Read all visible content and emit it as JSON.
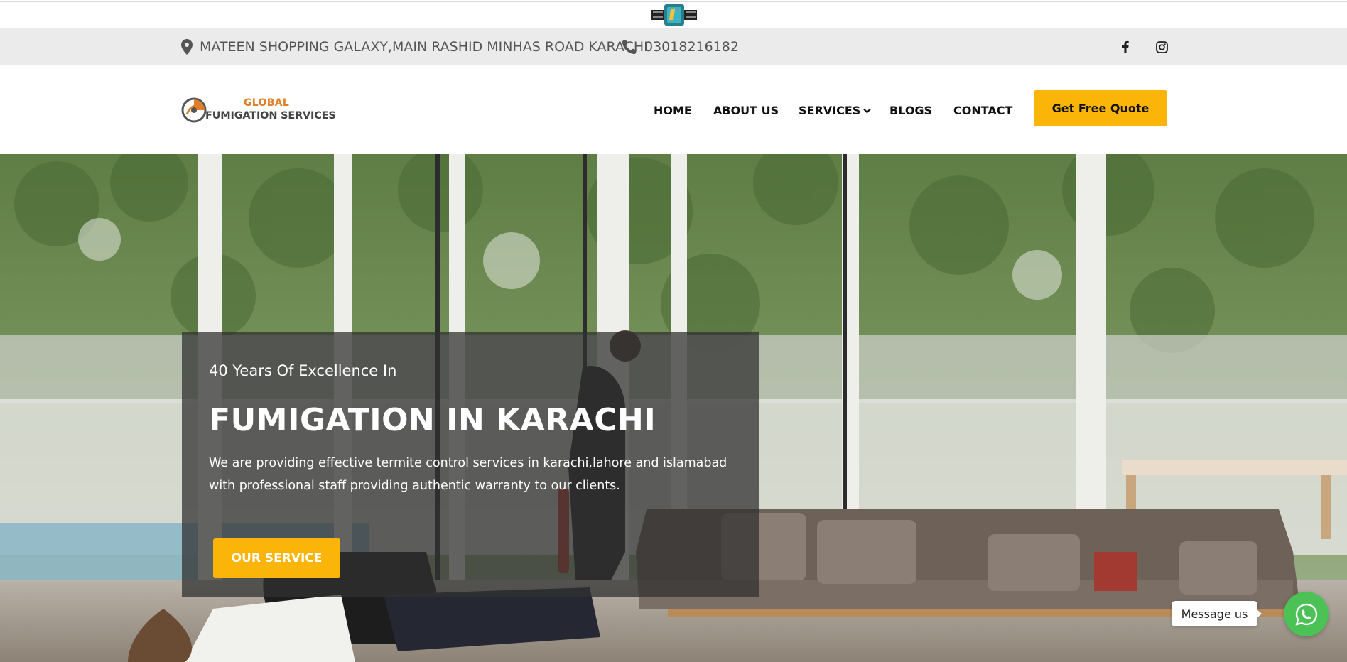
{
  "topbar": {
    "address": "MATEEN SHOPPING GALAXY,MAIN RASHID MINHAS ROAD KARACHI",
    "phone": "03018216182",
    "icons": {
      "address": "map-marker-icon",
      "phone": "phone-icon",
      "social": [
        "facebook-icon",
        "instagram-icon"
      ]
    }
  },
  "brand": {
    "logo_top": "GLOBAL",
    "logo_bottom": "FUMIGATION SERVICES",
    "accent": "#e07e2a"
  },
  "nav": {
    "items": [
      {
        "label": "HOME"
      },
      {
        "label": "ABOUT US"
      },
      {
        "label": "SERVICES",
        "icon": "chevron-down-icon"
      },
      {
        "label": "BLOGS"
      },
      {
        "label": "CONTACT"
      }
    ],
    "cta": "Get Free Quote"
  },
  "hero": {
    "subtitle": "40 Years Of Excellence In",
    "title": "FUMIGATION IN KARACHI",
    "description": "We are providing effective termite control services in karachi,lahore and islamabad with professional staff providing authentic warranty to our clients.",
    "button": "OUR SERVICE"
  },
  "chat": {
    "bubble": "Message us",
    "icon": "whatsapp-icon"
  },
  "colors": {
    "accent_yellow": "#fbb509",
    "whatsapp_green": "#4cc155",
    "info_bar_bg": "#ebebeb"
  }
}
